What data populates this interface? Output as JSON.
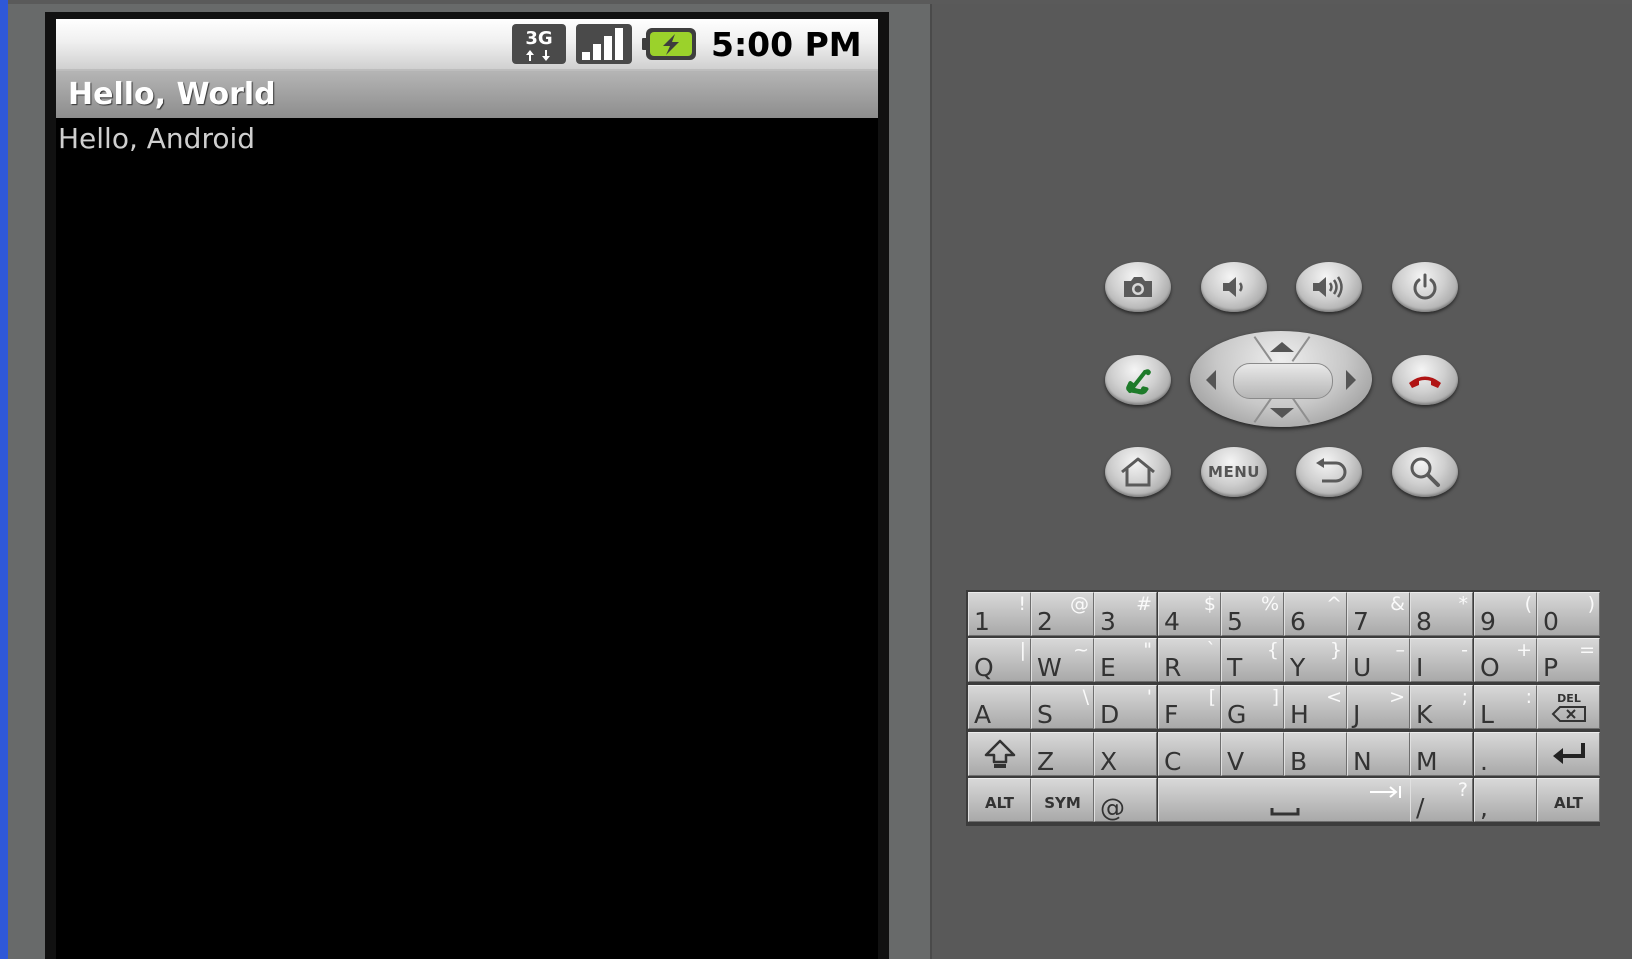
{
  "emulator": {
    "status_bar": {
      "network_icon": "3g-data-icon",
      "signal_icon": "signal-strength-icon",
      "battery_icon": "battery-charging-icon",
      "time": "5:00 PM",
      "network_label": "3G"
    },
    "app": {
      "title": "Hello, World",
      "content_text": "Hello, Android"
    },
    "controls": {
      "menu_label": "MENU",
      "buttons": [
        "camera-icon",
        "volume-down-icon",
        "volume-up-icon",
        "power-icon",
        "call-icon",
        "end-call-icon",
        "home-icon",
        "menu",
        "back-icon",
        "search-icon"
      ]
    },
    "keyboard": {
      "row1": [
        {
          "main": "1",
          "sec": "!"
        },
        {
          "main": "2",
          "sec": "@"
        },
        {
          "main": "3",
          "sec": "#"
        },
        {
          "main": "4",
          "sec": "$"
        },
        {
          "main": "5",
          "sec": "%"
        },
        {
          "main": "6",
          "sec": "^"
        },
        {
          "main": "7",
          "sec": "&"
        },
        {
          "main": "8",
          "sec": "*"
        },
        {
          "main": "9",
          "sec": "("
        },
        {
          "main": "0",
          "sec": ")"
        }
      ],
      "row2": [
        {
          "main": "Q",
          "sec": "|"
        },
        {
          "main": "W",
          "sec": "~"
        },
        {
          "main": "E",
          "sec": "\""
        },
        {
          "main": "R",
          "sec": "`"
        },
        {
          "main": "T",
          "sec": "{"
        },
        {
          "main": "Y",
          "sec": "}"
        },
        {
          "main": "U",
          "sec": "–"
        },
        {
          "main": "I",
          "sec": "-"
        },
        {
          "main": "O",
          "sec": "+"
        },
        {
          "main": "P",
          "sec": "="
        }
      ],
      "row3": [
        {
          "main": "A",
          "sec": ""
        },
        {
          "main": "S",
          "sec": "\\"
        },
        {
          "main": "D",
          "sec": "'"
        },
        {
          "main": "F",
          "sec": "["
        },
        {
          "main": "G",
          "sec": "]"
        },
        {
          "main": "H",
          "sec": "<"
        },
        {
          "main": "J",
          "sec": ">"
        },
        {
          "main": "K",
          "sec": ";"
        },
        {
          "main": "L",
          "sec": ":"
        }
      ],
      "row4": [
        {
          "main": "Z",
          "sec": ""
        },
        {
          "main": "X",
          "sec": ""
        },
        {
          "main": "C",
          "sec": ""
        },
        {
          "main": "V",
          "sec": ""
        },
        {
          "main": "B",
          "sec": ""
        },
        {
          "main": "N",
          "sec": ""
        },
        {
          "main": "M",
          "sec": ""
        },
        {
          "main": ".",
          "sec": ""
        }
      ],
      "alt_label": "ALT",
      "sym_label": "SYM",
      "at_label": "@",
      "slash_label": "/",
      "slash_sec": "?",
      "comma_label": ",",
      "del_label": "DEL"
    }
  }
}
